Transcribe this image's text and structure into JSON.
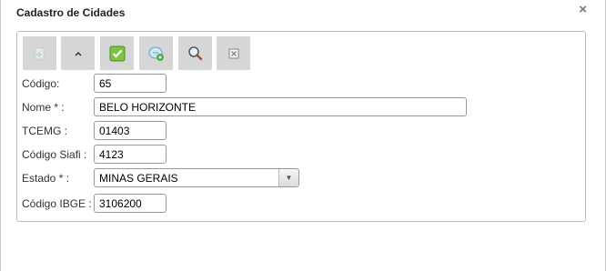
{
  "dialog": {
    "title": "Cadastro de Cidades",
    "close_glyph": "×"
  },
  "toolbar": {
    "buttons": [
      {
        "name": "add-button",
        "icon": "plus-doc-icon",
        "enabled": false
      },
      {
        "name": "collapse-button",
        "icon": "chevron-up-icon",
        "enabled": true
      },
      {
        "name": "save-button",
        "icon": "check-icon",
        "enabled": true
      },
      {
        "name": "refresh-button",
        "icon": "refresh-icon",
        "enabled": true
      },
      {
        "name": "search-button",
        "icon": "search-icon",
        "enabled": true
      },
      {
        "name": "cancel-button",
        "icon": "close-box-icon",
        "enabled": true
      }
    ]
  },
  "form": {
    "codigo": {
      "label": "Código:",
      "value": "65"
    },
    "nome": {
      "label": "Nome * :",
      "value": "BELO HORIZONTE"
    },
    "tcemg": {
      "label": "TCEMG :",
      "value": "01403"
    },
    "siafi": {
      "label": "Código Siafi :",
      "value": "4123"
    },
    "estado": {
      "label": "Estado * :",
      "value": "MINAS GERAIS"
    },
    "ibge": {
      "label": "Código IBGE :",
      "value": "3106200"
    }
  }
}
